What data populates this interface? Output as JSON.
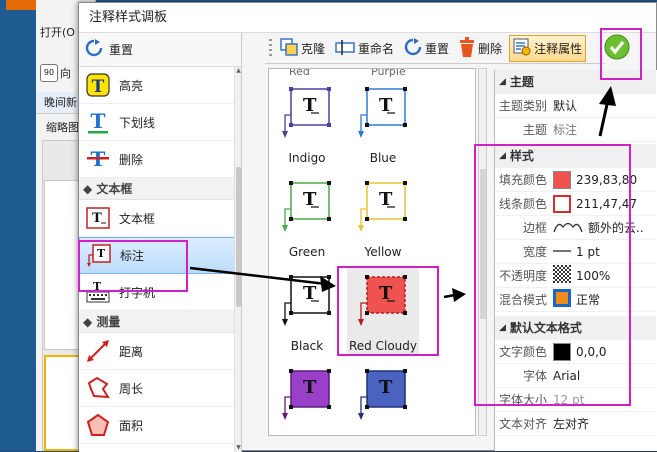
{
  "background_app": {
    "menu_open": "打开(O",
    "rotate_label": "向",
    "tab": "晚间新",
    "tab2": "缩略图"
  },
  "dialog": {
    "title": "注释样式调板"
  },
  "left": {
    "reset": "重置",
    "items": [
      {
        "label": "高亮",
        "icon": "highlight-icon"
      },
      {
        "label": "下划线",
        "icon": "underline-icon"
      },
      {
        "label": "删除",
        "icon": "strikeout-icon"
      }
    ],
    "group_textbox": "◆ 文本框",
    "textbox": "文本框",
    "callout": "标注",
    "typewriter": "打字机",
    "group_measure": "◆ 测量",
    "distance": "距离",
    "perimeter": "周长",
    "area": "面积"
  },
  "toolbar": {
    "clone": "克隆",
    "rename": "重命名",
    "reset": "重置",
    "delete": "删除",
    "annot_props": "注释属性"
  },
  "gallery": {
    "top_partial": [
      "Red",
      "Purple"
    ],
    "tiles": [
      {
        "name": "Indigo",
        "color": "#4b3fa0"
      },
      {
        "name": "Blue",
        "color": "#2c7bd6"
      },
      {
        "name": "Green",
        "color": "#4aa84a"
      },
      {
        "name": "Yellow",
        "color": "#e9c431"
      },
      {
        "name": "Black",
        "color": "#111111"
      },
      {
        "name": "Red Cloudy",
        "color": "#ef5350"
      }
    ],
    "bottom_fills": [
      "#9a3fc8",
      "#4a63c0"
    ]
  },
  "props": {
    "cat_theme": "主题",
    "theme_type_k": "主题类别",
    "theme_type_v": "默认",
    "theme_k": "主题",
    "theme_v": "标注",
    "cat_style": "样式",
    "fill_k": "填充颜色",
    "fill_v": "239,83,80",
    "fill_color": "#ef5350",
    "line_k": "线条颜色",
    "line_v": "211,47,47",
    "line_color": "#d32f2f",
    "border_k": "边框",
    "border_v": "额外的云..",
    "width_k": "宽度",
    "width_v": "1 pt",
    "opacity_k": "不透明度",
    "opacity_v": "100%",
    "blend_k": "混合模式",
    "blend_v": "正常",
    "cat_text": "默认文本格式",
    "textcolor_k": "文字颜色",
    "textcolor_v": "0,0,0",
    "font_k": "字体",
    "font_v": "Arial",
    "fontsize_k": "字体大小",
    "fontsize_v": "12 pt",
    "align_k": "文本对齐",
    "align_v": "左对齐"
  },
  "colors": {
    "highlight": "#d020c8",
    "accent": "#2c6cc8"
  }
}
